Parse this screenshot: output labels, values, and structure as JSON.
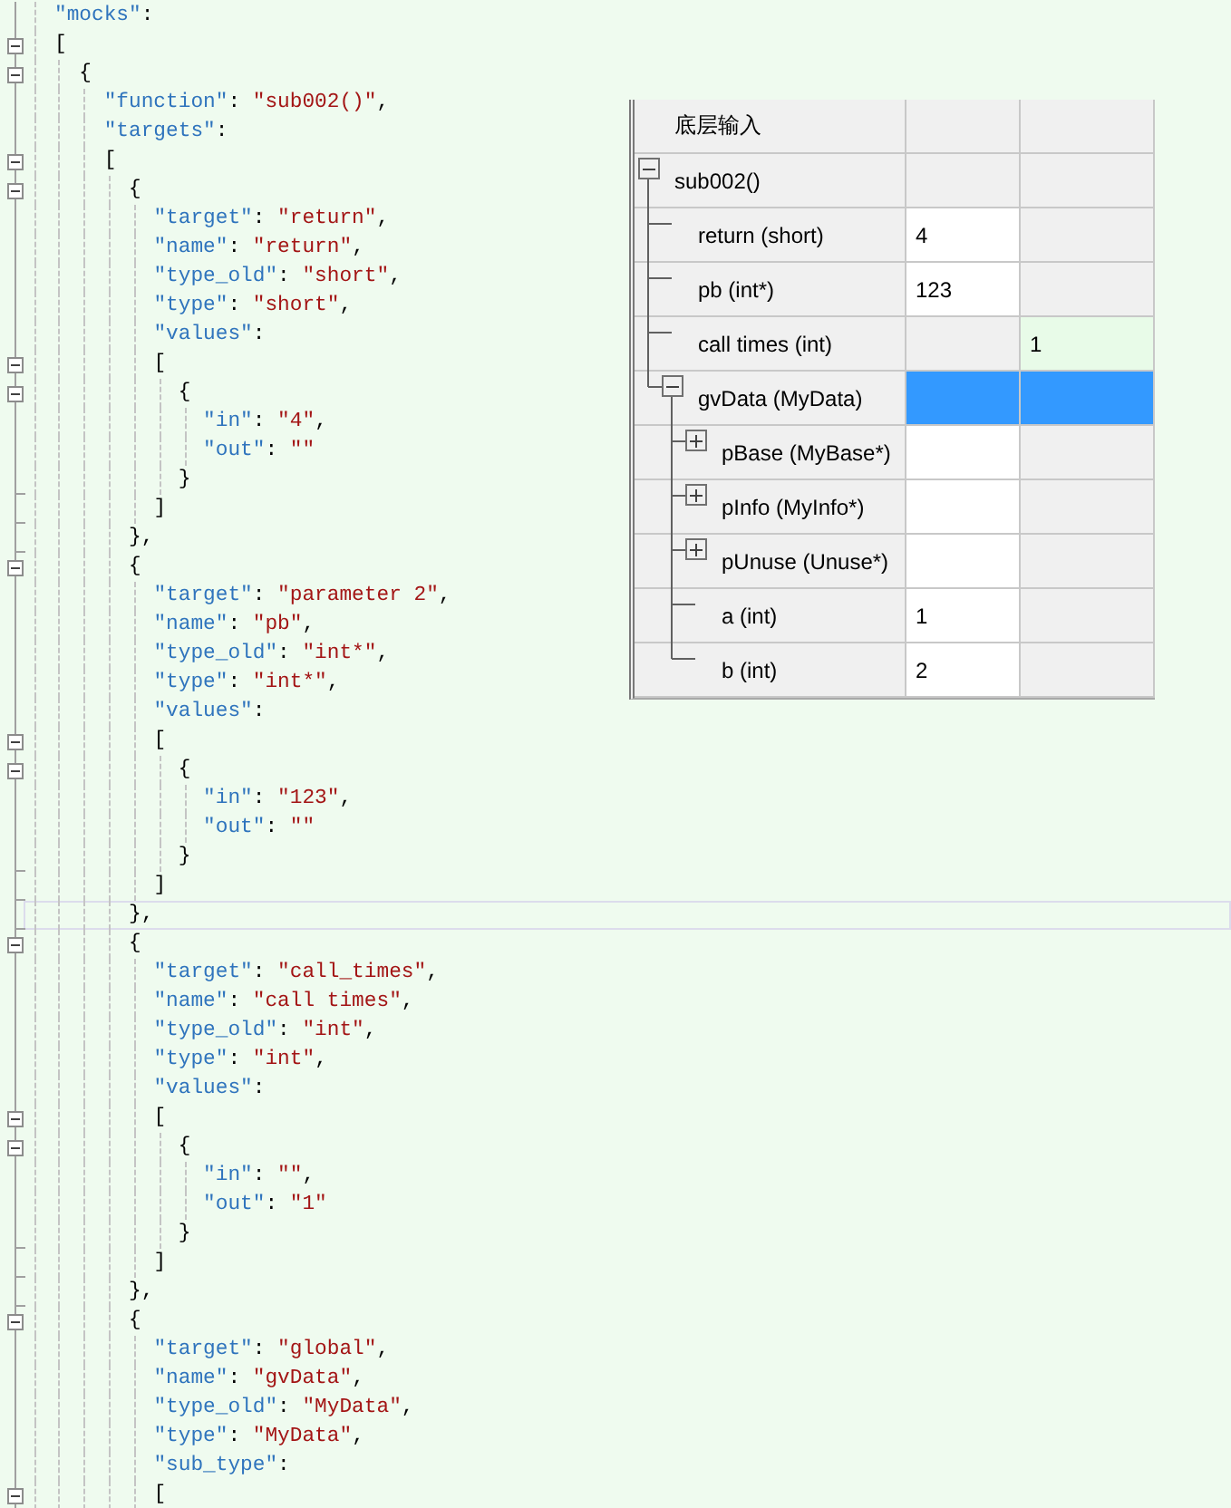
{
  "editor": {
    "lines": [
      {
        "kind": "plain",
        "current": false,
        "tokens": [
          {
            "kind": "key",
            "text": "\"mocks\""
          },
          {
            "kind": "punct",
            "text": ":"
          }
        ]
      },
      {
        "kind": "open",
        "current": false,
        "expanded": true,
        "tokens": [
          {
            "kind": "punct",
            "text": "["
          }
        ]
      },
      {
        "kind": "open",
        "current": false,
        "expanded": true,
        "tokens": [
          {
            "kind": "punct",
            "text": "  {"
          }
        ]
      },
      {
        "kind": "plain",
        "current": false,
        "tokens": [
          {
            "kind": "key",
            "text": "    \"function\""
          },
          {
            "kind": "punct",
            "text": ": "
          },
          {
            "kind": "string",
            "text": "\"sub002()\""
          },
          {
            "kind": "punct",
            "text": ","
          }
        ]
      },
      {
        "kind": "plain",
        "current": false,
        "tokens": [
          {
            "kind": "key",
            "text": "    \"targets\""
          },
          {
            "kind": "punct",
            "text": ":"
          }
        ]
      },
      {
        "kind": "open",
        "current": false,
        "expanded": true,
        "tokens": [
          {
            "kind": "punct",
            "text": "    ["
          }
        ]
      },
      {
        "kind": "open",
        "current": false,
        "expanded": true,
        "tokens": [
          {
            "kind": "punct",
            "text": "      {"
          }
        ]
      },
      {
        "kind": "plain",
        "current": false,
        "tokens": [
          {
            "kind": "key",
            "text": "        \"target\""
          },
          {
            "kind": "punct",
            "text": ": "
          },
          {
            "kind": "string",
            "text": "\"return\""
          },
          {
            "kind": "punct",
            "text": ","
          }
        ]
      },
      {
        "kind": "plain",
        "current": false,
        "tokens": [
          {
            "kind": "key",
            "text": "        \"name\""
          },
          {
            "kind": "punct",
            "text": ": "
          },
          {
            "kind": "string",
            "text": "\"return\""
          },
          {
            "kind": "punct",
            "text": ","
          }
        ]
      },
      {
        "kind": "plain",
        "current": false,
        "tokens": [
          {
            "kind": "key",
            "text": "        \"type_old\""
          },
          {
            "kind": "punct",
            "text": ": "
          },
          {
            "kind": "string",
            "text": "\"short\""
          },
          {
            "kind": "punct",
            "text": ","
          }
        ]
      },
      {
        "kind": "plain",
        "current": false,
        "tokens": [
          {
            "kind": "key",
            "text": "        \"type\""
          },
          {
            "kind": "punct",
            "text": ": "
          },
          {
            "kind": "string",
            "text": "\"short\""
          },
          {
            "kind": "punct",
            "text": ","
          }
        ]
      },
      {
        "kind": "plain",
        "current": false,
        "tokens": [
          {
            "kind": "key",
            "text": "        \"values\""
          },
          {
            "kind": "punct",
            "text": ":"
          }
        ]
      },
      {
        "kind": "open",
        "current": false,
        "expanded": true,
        "tokens": [
          {
            "kind": "punct",
            "text": "        ["
          }
        ]
      },
      {
        "kind": "open",
        "current": false,
        "expanded": true,
        "tokens": [
          {
            "kind": "punct",
            "text": "          {"
          }
        ]
      },
      {
        "kind": "plain",
        "current": false,
        "tokens": [
          {
            "kind": "key",
            "text": "            \"in\""
          },
          {
            "kind": "punct",
            "text": ": "
          },
          {
            "kind": "string",
            "text": "\"4\""
          },
          {
            "kind": "punct",
            "text": ","
          }
        ]
      },
      {
        "kind": "plain",
        "current": false,
        "tokens": [
          {
            "kind": "key",
            "text": "            \"out\""
          },
          {
            "kind": "punct",
            "text": ": "
          },
          {
            "kind": "string",
            "text": "\"\""
          }
        ]
      },
      {
        "kind": "close",
        "current": false,
        "tokens": [
          {
            "kind": "punct",
            "text": "          }"
          }
        ]
      },
      {
        "kind": "close",
        "current": false,
        "tokens": [
          {
            "kind": "punct",
            "text": "        ]"
          }
        ]
      },
      {
        "kind": "close",
        "current": false,
        "tokens": [
          {
            "kind": "punct",
            "text": "      },"
          }
        ]
      },
      {
        "kind": "open",
        "current": false,
        "expanded": true,
        "tokens": [
          {
            "kind": "punct",
            "text": "      {"
          }
        ]
      },
      {
        "kind": "plain",
        "current": false,
        "tokens": [
          {
            "kind": "key",
            "text": "        \"target\""
          },
          {
            "kind": "punct",
            "text": ": "
          },
          {
            "kind": "string",
            "text": "\"parameter 2\""
          },
          {
            "kind": "punct",
            "text": ","
          }
        ]
      },
      {
        "kind": "plain",
        "current": false,
        "tokens": [
          {
            "kind": "key",
            "text": "        \"name\""
          },
          {
            "kind": "punct",
            "text": ": "
          },
          {
            "kind": "string",
            "text": "\"pb\""
          },
          {
            "kind": "punct",
            "text": ","
          }
        ]
      },
      {
        "kind": "plain",
        "current": false,
        "tokens": [
          {
            "kind": "key",
            "text": "        \"type_old\""
          },
          {
            "kind": "punct",
            "text": ": "
          },
          {
            "kind": "string",
            "text": "\"int*\""
          },
          {
            "kind": "punct",
            "text": ","
          }
        ]
      },
      {
        "kind": "plain",
        "current": false,
        "tokens": [
          {
            "kind": "key",
            "text": "        \"type\""
          },
          {
            "kind": "punct",
            "text": ": "
          },
          {
            "kind": "string",
            "text": "\"int*\""
          },
          {
            "kind": "punct",
            "text": ","
          }
        ]
      },
      {
        "kind": "plain",
        "current": false,
        "tokens": [
          {
            "kind": "key",
            "text": "        \"values\""
          },
          {
            "kind": "punct",
            "text": ":"
          }
        ]
      },
      {
        "kind": "open",
        "current": false,
        "expanded": true,
        "tokens": [
          {
            "kind": "punct",
            "text": "        ["
          }
        ]
      },
      {
        "kind": "open",
        "current": false,
        "expanded": true,
        "tokens": [
          {
            "kind": "punct",
            "text": "          {"
          }
        ]
      },
      {
        "kind": "plain",
        "current": false,
        "tokens": [
          {
            "kind": "key",
            "text": "            \"in\""
          },
          {
            "kind": "punct",
            "text": ": "
          },
          {
            "kind": "string",
            "text": "\"123\""
          },
          {
            "kind": "punct",
            "text": ","
          }
        ]
      },
      {
        "kind": "plain",
        "current": false,
        "tokens": [
          {
            "kind": "key",
            "text": "            \"out\""
          },
          {
            "kind": "punct",
            "text": ": "
          },
          {
            "kind": "string",
            "text": "\"\""
          }
        ]
      },
      {
        "kind": "close",
        "current": false,
        "tokens": [
          {
            "kind": "punct",
            "text": "          }"
          }
        ]
      },
      {
        "kind": "close",
        "current": false,
        "tokens": [
          {
            "kind": "punct",
            "text": "        ]"
          }
        ]
      },
      {
        "kind": "close",
        "current": true,
        "tokens": [
          {
            "kind": "punct",
            "text": "      },"
          }
        ]
      },
      {
        "kind": "open",
        "current": false,
        "expanded": true,
        "tokens": [
          {
            "kind": "punct",
            "text": "      {"
          }
        ]
      },
      {
        "kind": "plain",
        "current": false,
        "tokens": [
          {
            "kind": "key",
            "text": "        \"target\""
          },
          {
            "kind": "punct",
            "text": ": "
          },
          {
            "kind": "string",
            "text": "\"call_times\""
          },
          {
            "kind": "punct",
            "text": ","
          }
        ]
      },
      {
        "kind": "plain",
        "current": false,
        "tokens": [
          {
            "kind": "key",
            "text": "        \"name\""
          },
          {
            "kind": "punct",
            "text": ": "
          },
          {
            "kind": "string",
            "text": "\"call times\""
          },
          {
            "kind": "punct",
            "text": ","
          }
        ]
      },
      {
        "kind": "plain",
        "current": false,
        "tokens": [
          {
            "kind": "key",
            "text": "        \"type_old\""
          },
          {
            "kind": "punct",
            "text": ": "
          },
          {
            "kind": "string",
            "text": "\"int\""
          },
          {
            "kind": "punct",
            "text": ","
          }
        ]
      },
      {
        "kind": "plain",
        "current": false,
        "tokens": [
          {
            "kind": "key",
            "text": "        \"type\""
          },
          {
            "kind": "punct",
            "text": ": "
          },
          {
            "kind": "string",
            "text": "\"int\""
          },
          {
            "kind": "punct",
            "text": ","
          }
        ]
      },
      {
        "kind": "plain",
        "current": false,
        "tokens": [
          {
            "kind": "key",
            "text": "        \"values\""
          },
          {
            "kind": "punct",
            "text": ":"
          }
        ]
      },
      {
        "kind": "open",
        "current": false,
        "expanded": true,
        "tokens": [
          {
            "kind": "punct",
            "text": "        ["
          }
        ]
      },
      {
        "kind": "open",
        "current": false,
        "expanded": true,
        "tokens": [
          {
            "kind": "punct",
            "text": "          {"
          }
        ]
      },
      {
        "kind": "plain",
        "current": false,
        "tokens": [
          {
            "kind": "key",
            "text": "            \"in\""
          },
          {
            "kind": "punct",
            "text": ": "
          },
          {
            "kind": "string",
            "text": "\"\""
          },
          {
            "kind": "punct",
            "text": ","
          }
        ]
      },
      {
        "kind": "plain",
        "current": false,
        "tokens": [
          {
            "kind": "key",
            "text": "            \"out\""
          },
          {
            "kind": "punct",
            "text": ": "
          },
          {
            "kind": "string",
            "text": "\"1\""
          }
        ]
      },
      {
        "kind": "close",
        "current": false,
        "tokens": [
          {
            "kind": "punct",
            "text": "          }"
          }
        ]
      },
      {
        "kind": "close",
        "current": false,
        "tokens": [
          {
            "kind": "punct",
            "text": "        ]"
          }
        ]
      },
      {
        "kind": "close",
        "current": false,
        "tokens": [
          {
            "kind": "punct",
            "text": "      },"
          }
        ]
      },
      {
        "kind": "open",
        "current": false,
        "expanded": true,
        "tokens": [
          {
            "kind": "punct",
            "text": "      {"
          }
        ]
      },
      {
        "kind": "plain",
        "current": false,
        "tokens": [
          {
            "kind": "key",
            "text": "        \"target\""
          },
          {
            "kind": "punct",
            "text": ": "
          },
          {
            "kind": "string",
            "text": "\"global\""
          },
          {
            "kind": "punct",
            "text": ","
          }
        ]
      },
      {
        "kind": "plain",
        "current": false,
        "tokens": [
          {
            "kind": "key",
            "text": "        \"name\""
          },
          {
            "kind": "punct",
            "text": ": "
          },
          {
            "kind": "string",
            "text": "\"gvData\""
          },
          {
            "kind": "punct",
            "text": ","
          }
        ]
      },
      {
        "kind": "plain",
        "current": false,
        "tokens": [
          {
            "kind": "key",
            "text": "        \"type_old\""
          },
          {
            "kind": "punct",
            "text": ": "
          },
          {
            "kind": "string",
            "text": "\"MyData\""
          },
          {
            "kind": "punct",
            "text": ","
          }
        ]
      },
      {
        "kind": "plain",
        "current": false,
        "tokens": [
          {
            "kind": "key",
            "text": "        \"type\""
          },
          {
            "kind": "punct",
            "text": ": "
          },
          {
            "kind": "string",
            "text": "\"MyData\""
          },
          {
            "kind": "punct",
            "text": ","
          }
        ]
      },
      {
        "kind": "plain",
        "current": false,
        "tokens": [
          {
            "kind": "key",
            "text": "        \"sub_type\""
          },
          {
            "kind": "punct",
            "text": ":"
          }
        ]
      },
      {
        "kind": "open",
        "current": false,
        "expanded": true,
        "tokens": [
          {
            "kind": "punct",
            "text": "        ["
          }
        ]
      }
    ]
  },
  "grid": {
    "header": "底层输入",
    "rows": [
      {
        "label": "sub002()",
        "expanded": true,
        "selected": false,
        "cells": [
          {
            "kind": "blank"
          },
          {
            "kind": "blank"
          }
        ],
        "children": [
          {
            "label": "return (short)",
            "selected": false,
            "cells": [
              {
                "kind": "field",
                "text": "4"
              },
              {
                "kind": "blank"
              }
            ]
          },
          {
            "label": "pb (int*)",
            "selected": false,
            "cells": [
              {
                "kind": "field",
                "text": "123"
              },
              {
                "kind": "blank"
              }
            ]
          },
          {
            "label": "call times (int)",
            "selected": false,
            "cells": [
              {
                "kind": "blank"
              },
              {
                "kind": "output",
                "text": "1"
              }
            ]
          },
          {
            "label": "gvData (MyData)",
            "expanded": true,
            "selected": true,
            "cells": [
              {
                "kind": "blank"
              },
              {
                "kind": "blank"
              }
            ],
            "children": [
              {
                "label": "pBase (MyBase*)",
                "expanded": false,
                "selected": false,
                "cells": [
                  {
                    "kind": "field"
                  },
                  {
                    "kind": "blank"
                  }
                ]
              },
              {
                "label": "pInfo (MyInfo*)",
                "expanded": false,
                "selected": false,
                "cells": [
                  {
                    "kind": "field"
                  },
                  {
                    "kind": "blank"
                  }
                ]
              },
              {
                "label": "pUnuse (Unuse*)",
                "expanded": false,
                "selected": false,
                "cells": [
                  {
                    "kind": "field"
                  },
                  {
                    "kind": "blank"
                  }
                ]
              },
              {
                "label": "a (int)",
                "selected": false,
                "cells": [
                  {
                    "kind": "field",
                    "text": "1"
                  },
                  {
                    "kind": "blank"
                  }
                ]
              },
              {
                "label": "b (int)",
                "selected": false,
                "cells": [
                  {
                    "kind": "field",
                    "text": "2"
                  },
                  {
                    "kind": "blank"
                  }
                ]
              }
            ]
          }
        ]
      }
    ]
  }
}
